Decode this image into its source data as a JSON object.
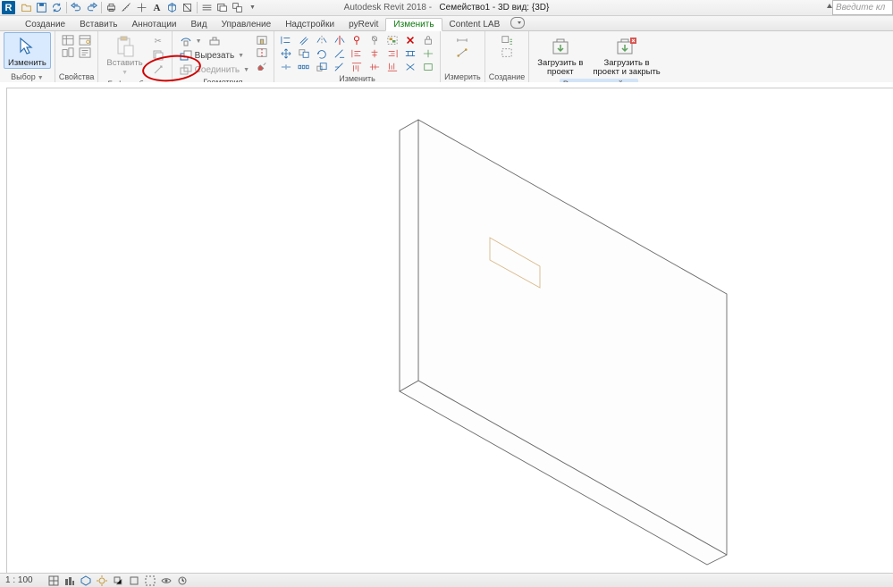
{
  "app": {
    "title_prefix": "Autodesk Revit 2018 -",
    "doc_title": "Семейство1 - 3D вид: {3D}"
  },
  "search": {
    "placeholder": "Введите кл"
  },
  "tabs": [
    "Создание",
    "Вставить",
    "Аннотации",
    "Вид",
    "Управление",
    "Надстройки",
    "pyRevit",
    "Изменить",
    "Content LAB"
  ],
  "active_tab": "Изменить",
  "ribbon": {
    "select": {
      "label": "Изменить",
      "panel": "Выбор"
    },
    "properties": {
      "panel": "Свойства"
    },
    "clipboard": {
      "paste": "Вставить",
      "panel": "Буфер обмена"
    },
    "geometry": {
      "cut": "Вырезать",
      "join": "Соединить",
      "panel": "Геометрия"
    },
    "modify": {
      "panel": "Изменить"
    },
    "measure": {
      "panel": "Измерить"
    },
    "create": {
      "panel": "Создание"
    },
    "family": {
      "load": "Загрузить в\nпроект",
      "load_close": "Загрузить в\nпроект и закрыть",
      "panel": "Редактор семейств"
    }
  },
  "status": {
    "scale": "1 : 100"
  }
}
